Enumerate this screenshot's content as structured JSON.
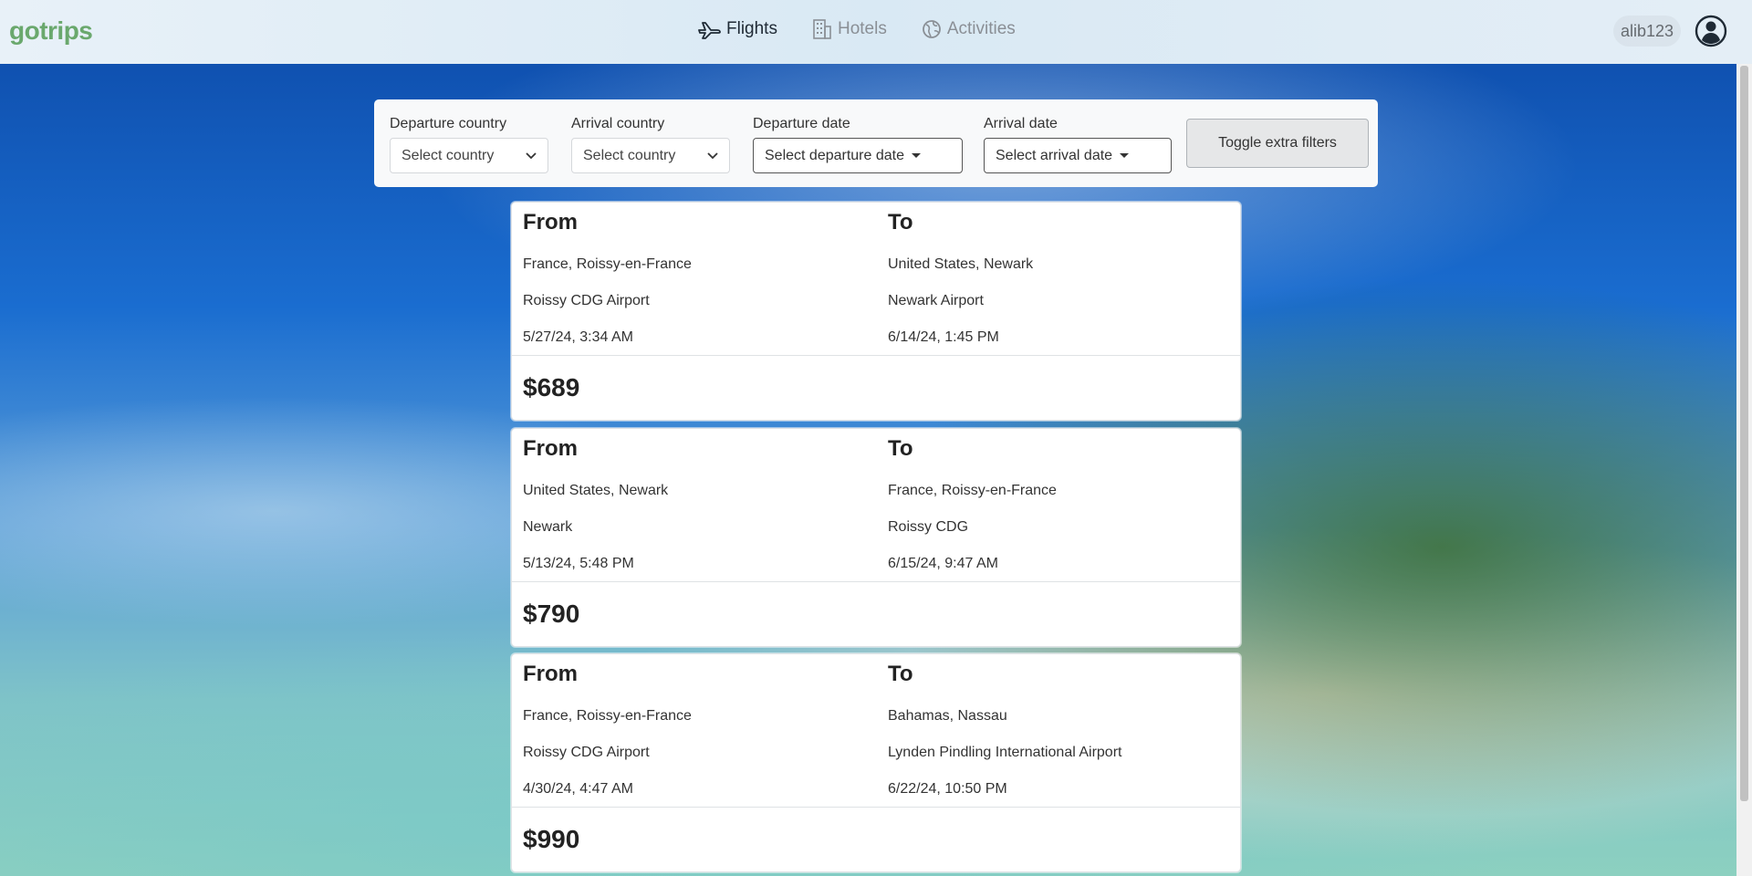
{
  "header": {
    "logo": "gotrips",
    "nav": [
      {
        "label": "Flights",
        "icon": "plane-icon",
        "active": true
      },
      {
        "label": "Hotels",
        "icon": "building-icon",
        "active": false
      },
      {
        "label": "Activities",
        "icon": "globe-icon",
        "active": false
      }
    ],
    "username": "alib123"
  },
  "filters": {
    "departure_country_label": "Departure country",
    "departure_country_value": "Select country",
    "arrival_country_label": "Arrival country",
    "arrival_country_value": "Select country",
    "departure_date_label": "Departure date",
    "departure_date_value": "Select departure date",
    "arrival_date_label": "Arrival date",
    "arrival_date_value": "Select arrival date",
    "toggle_label": "Toggle extra filters"
  },
  "flights": [
    {
      "from_heading": "From",
      "to_heading": "To",
      "from_location": "France, Roissy-en-France",
      "from_airport": "Roissy CDG Airport",
      "from_datetime": "5/27/24, 3:34 AM",
      "to_location": "United States, Newark",
      "to_airport": "Newark Airport",
      "to_datetime": "6/14/24, 1:45 PM",
      "price": "$689"
    },
    {
      "from_heading": "From",
      "to_heading": "To",
      "from_location": "United States, Newark",
      "from_airport": "Newark",
      "from_datetime": "5/13/24, 5:48 PM",
      "to_location": "France, Roissy-en-France",
      "to_airport": "Roissy CDG",
      "to_datetime": "6/15/24, 9:47 AM",
      "price": "$790"
    },
    {
      "from_heading": "From",
      "to_heading": "To",
      "from_location": "France, Roissy-en-France",
      "from_airport": "Roissy CDG Airport",
      "from_datetime": "4/30/24, 4:47 AM",
      "to_location": "Bahamas, Nassau",
      "to_airport": "Lynden Pindling International Airport",
      "to_datetime": "6/22/24, 10:50 PM",
      "price": "$990"
    }
  ],
  "colors": {
    "logo": "#6aa86d",
    "nav_active": "#1f2a35",
    "nav_inactive": "#8a8f95"
  }
}
